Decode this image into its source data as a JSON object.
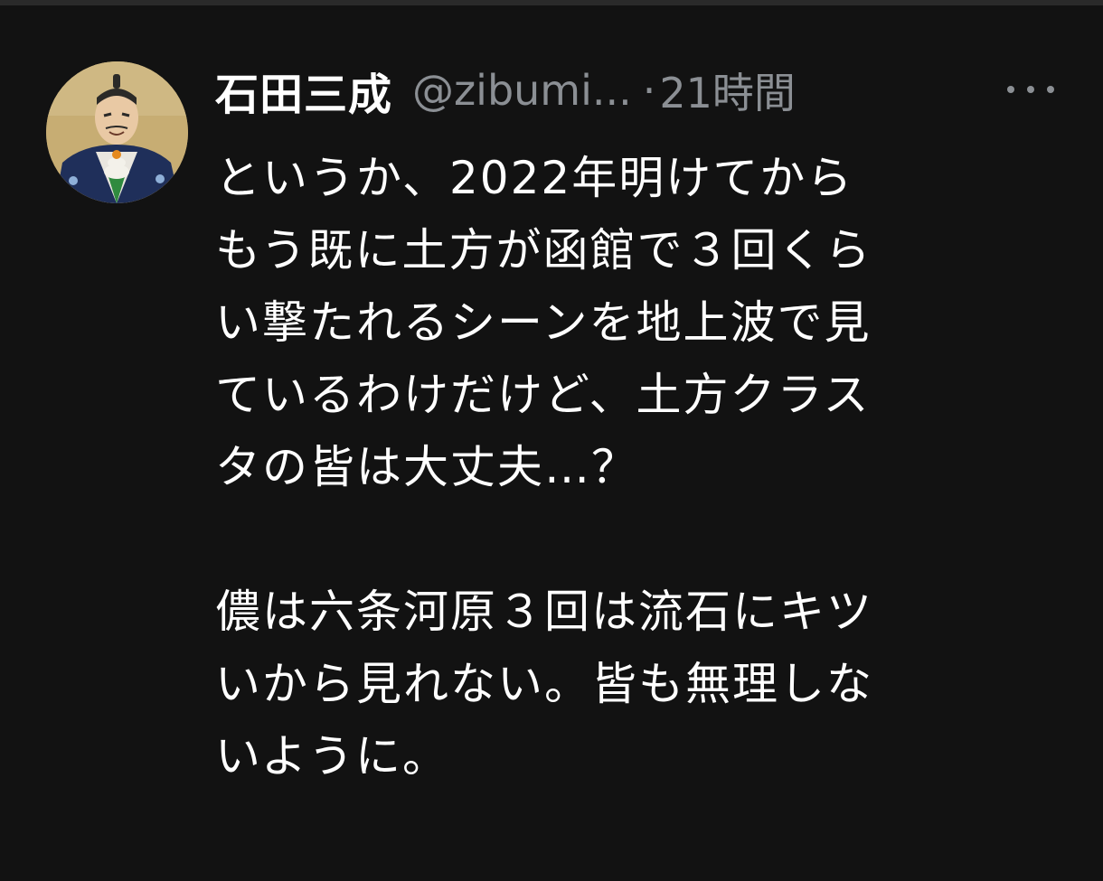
{
  "tweet": {
    "author": {
      "display_name": "石田三成",
      "handle": "@zibumi...",
      "avatar_icon": "samurai-portrait-avatar"
    },
    "separator": "·",
    "timestamp": "21時間",
    "more_icon": "more-options-icon",
    "body": {
      "paragraph1": [
        "というか、2022年明けてから",
        "もう既に土方が函館で３回くら",
        "い撃たれるシーンを地上波で見",
        "ているわけだけど、土方クラス",
        "タの皆は大丈夫…？"
      ],
      "paragraph2": [
        "儂は六条河原３回は流石にキツ",
        "いから見れない。皆も無理しな",
        "いように。"
      ]
    }
  },
  "colors": {
    "background": "#121212",
    "primary_text": "#ffffff",
    "secondary_text": "#8b8f94"
  }
}
